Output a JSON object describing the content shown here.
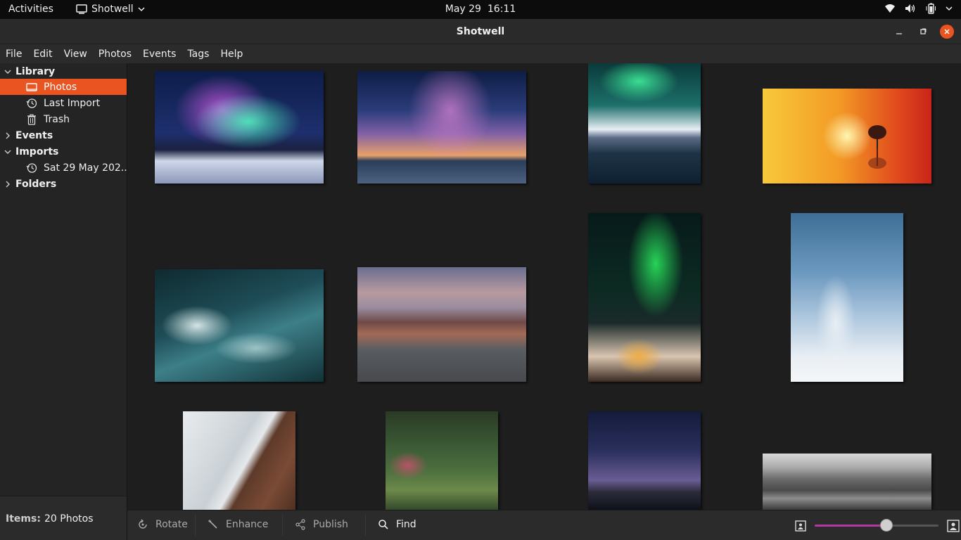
{
  "topbar": {
    "activities": "Activities",
    "app_name": "Shotwell",
    "date": "May 29",
    "time": "16:11"
  },
  "window": {
    "title": "Shotwell"
  },
  "menu": [
    "File",
    "Edit",
    "View",
    "Photos",
    "Events",
    "Tags",
    "Help"
  ],
  "sidebar": {
    "library": "Library",
    "photos": "Photos",
    "last_import": "Last Import",
    "trash": "Trash",
    "events": "Events",
    "imports": "Imports",
    "import_item": "Sat 29 May 202...",
    "folders": "Folders"
  },
  "status": {
    "items_label": "Items:",
    "items_value": "20 Photos"
  },
  "toolbar": {
    "rotate": "Rotate",
    "enhance": "Enhance",
    "publish": "Publish",
    "find": "Find",
    "zoom_fraction": 0.58
  },
  "colors": {
    "accent": "#e95420",
    "slider_fill": "#b03a9f"
  }
}
